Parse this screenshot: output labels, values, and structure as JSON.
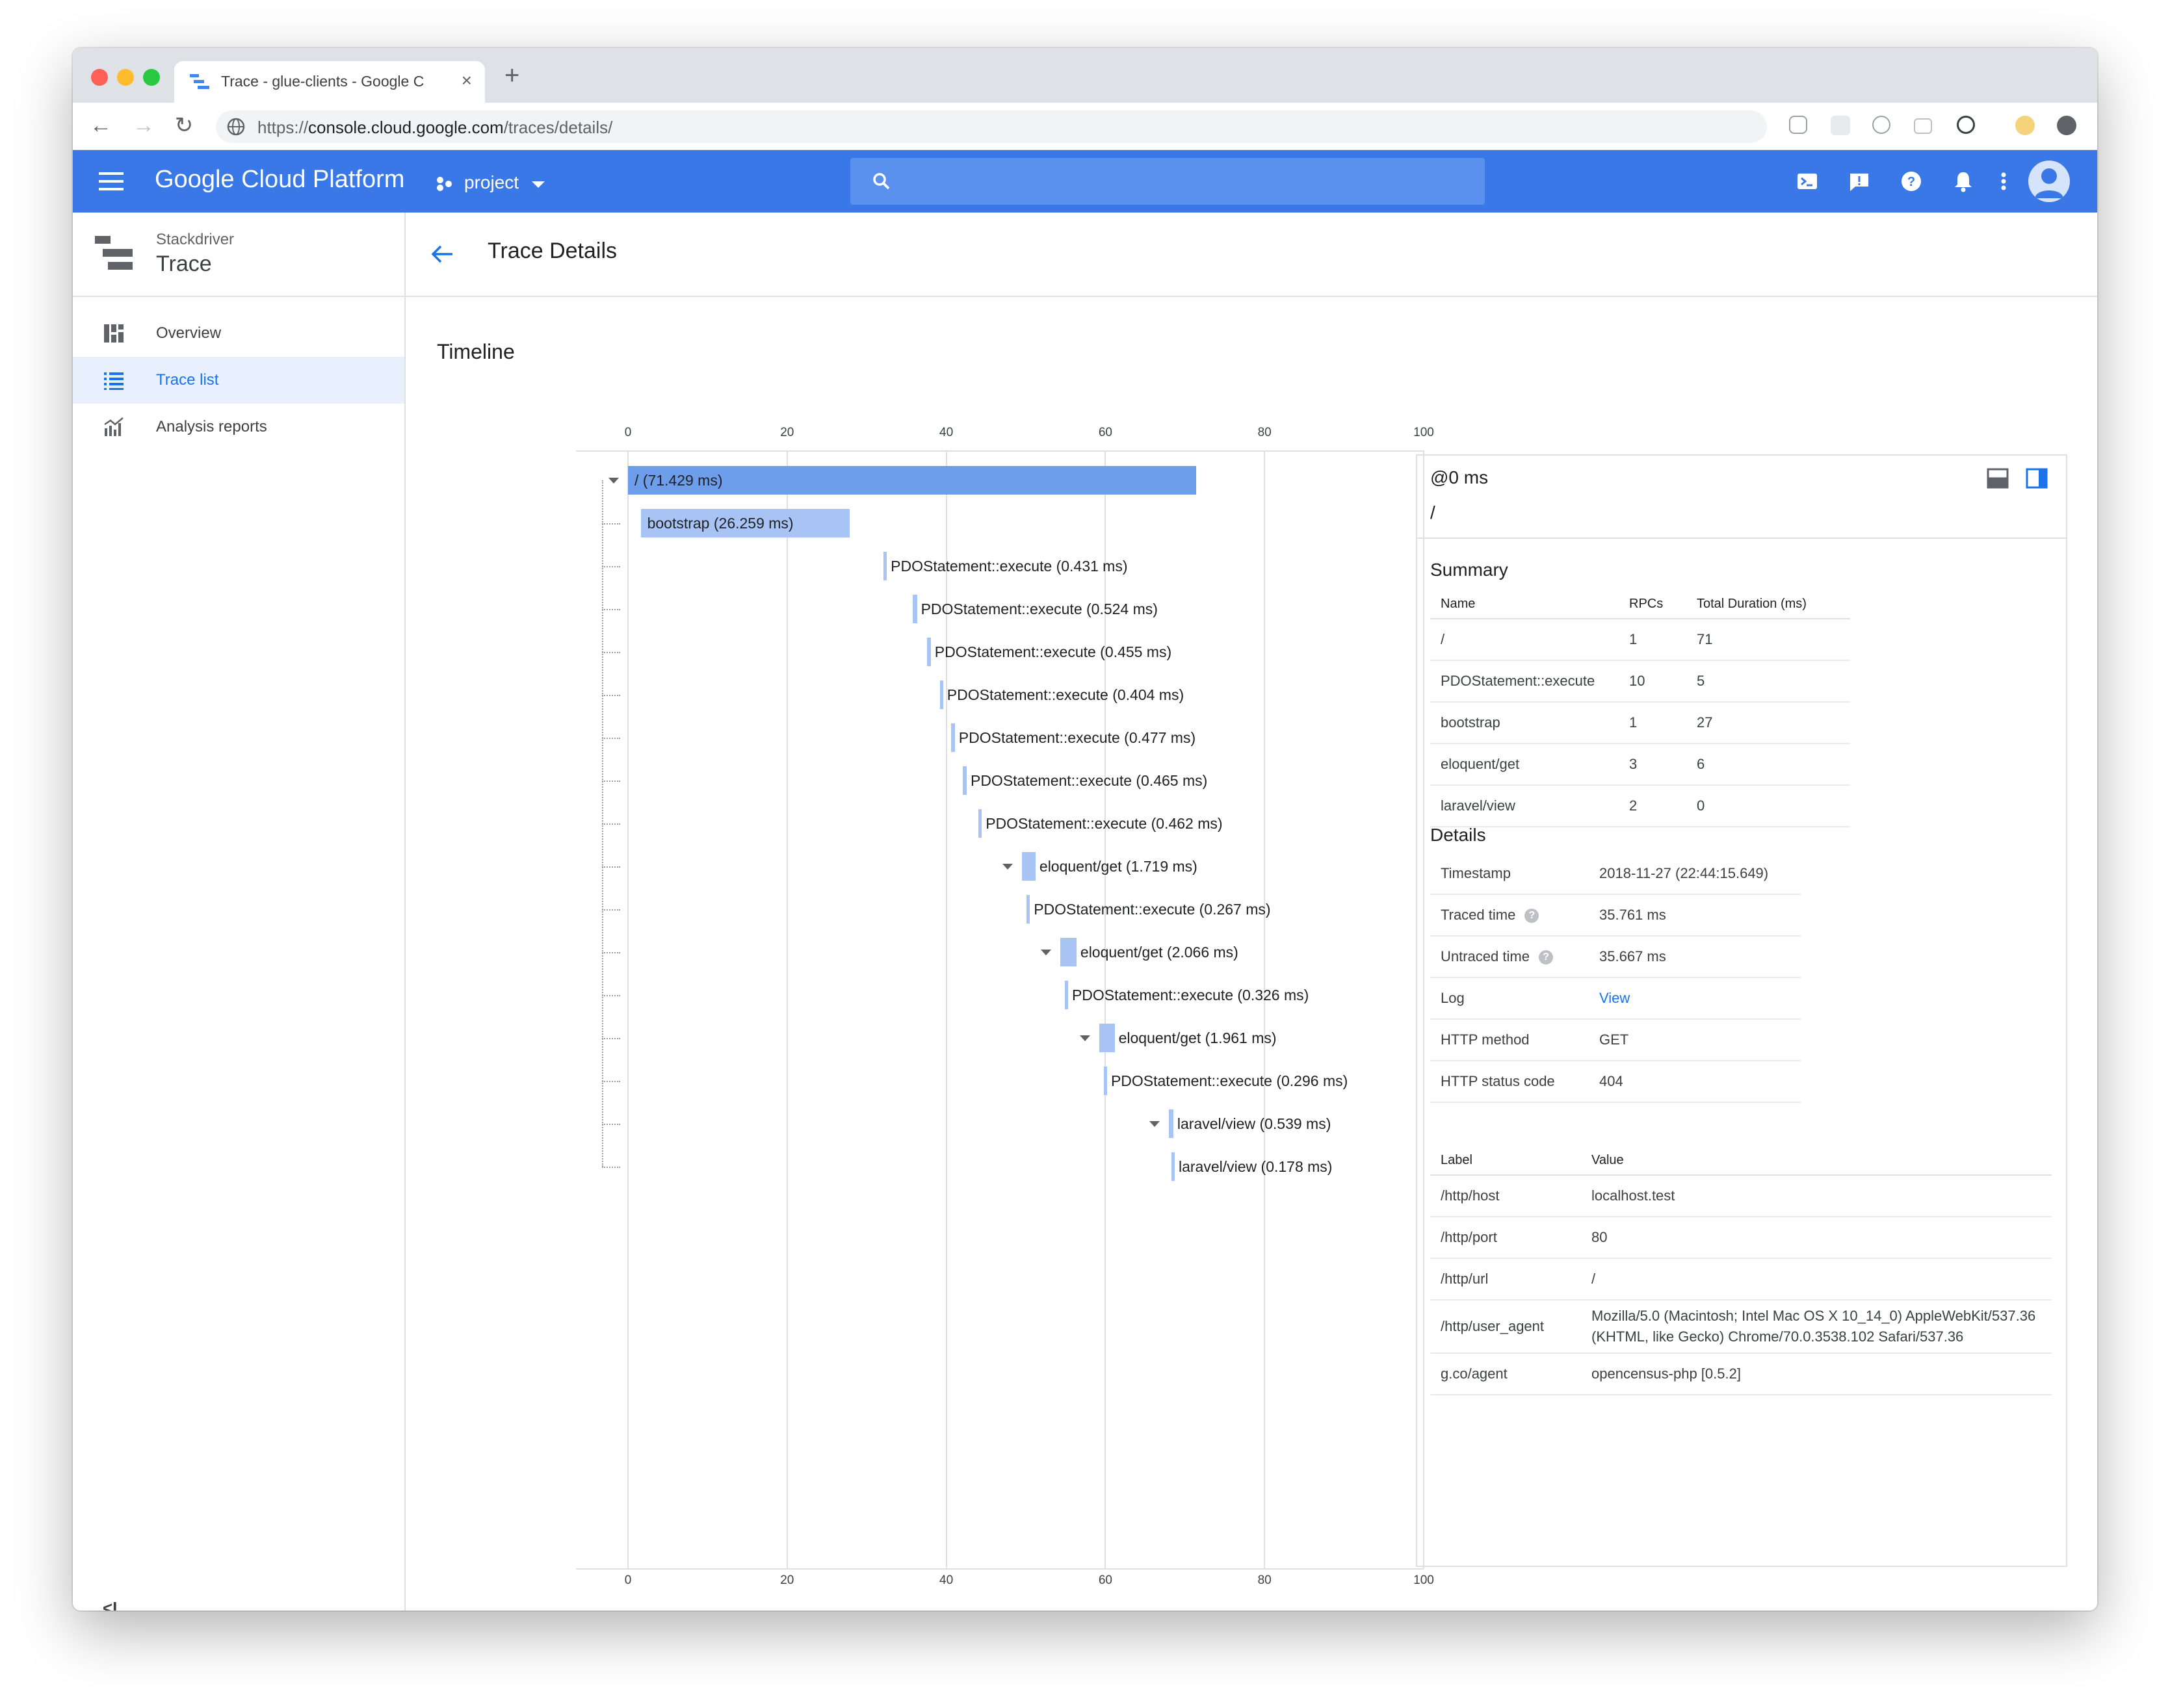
{
  "browser": {
    "tab_title": "Trace - glue-clients - Google C",
    "url_scheme": "https://",
    "url_host": "console.cloud.google.com",
    "url_path": "/traces/details/"
  },
  "header": {
    "logo": "Google Cloud Platform",
    "project_label": "project"
  },
  "sidebar": {
    "product_sub": "Stackdriver",
    "product_name": "Trace",
    "items": [
      {
        "label": "Overview",
        "icon": "dashboard-icon",
        "active": false
      },
      {
        "label": "Trace list",
        "icon": "list-icon",
        "active": true
      },
      {
        "label": "Analysis reports",
        "icon": "analytics-icon",
        "active": false
      }
    ],
    "collapse_glyph": "<I"
  },
  "page": {
    "title": "Trace Details",
    "timeline_title": "Timeline"
  },
  "chart_data": {
    "type": "bar",
    "axis_ticks": [
      "0",
      "20",
      "40",
      "60",
      "80",
      "100"
    ],
    "xlim": [
      0,
      100
    ],
    "spans": [
      {
        "label": "/ (71.429 ms)",
        "start": 0,
        "duration": 71.429,
        "depth": 0,
        "collapsible": true,
        "color": "#6d9eeb",
        "inside": true
      },
      {
        "label": "bootstrap (26.259 ms)",
        "start": 1.6,
        "duration": 26.259,
        "depth": 1,
        "collapsible": false,
        "color": "#a8c4f5",
        "inside": true
      },
      {
        "label": "PDOStatement::execute (0.431 ms)",
        "start": 32.1,
        "duration": 0.431,
        "depth": 1,
        "collapsible": false,
        "color": "#a8c4f5",
        "inside": false
      },
      {
        "label": "PDOStatement::execute (0.524 ms)",
        "start": 35.8,
        "duration": 0.524,
        "depth": 1,
        "collapsible": false,
        "color": "#a8c4f5",
        "inside": false
      },
      {
        "label": "PDOStatement::execute (0.455 ms)",
        "start": 37.6,
        "duration": 0.455,
        "depth": 1,
        "collapsible": false,
        "color": "#a8c4f5",
        "inside": false
      },
      {
        "label": "PDOStatement::execute (0.404 ms)",
        "start": 39.2,
        "duration": 0.404,
        "depth": 1,
        "collapsible": false,
        "color": "#a8c4f5",
        "inside": false
      },
      {
        "label": "PDOStatement::execute (0.477 ms)",
        "start": 40.6,
        "duration": 0.477,
        "depth": 1,
        "collapsible": false,
        "color": "#a8c4f5",
        "inside": false
      },
      {
        "label": "PDOStatement::execute (0.465 ms)",
        "start": 42.1,
        "duration": 0.465,
        "depth": 1,
        "collapsible": false,
        "color": "#a8c4f5",
        "inside": false
      },
      {
        "label": "PDOStatement::execute (0.462 ms)",
        "start": 44.0,
        "duration": 0.462,
        "depth": 1,
        "collapsible": false,
        "color": "#a8c4f5",
        "inside": false
      },
      {
        "label": "eloquent/get (1.719 ms)",
        "start": 49.5,
        "duration": 1.719,
        "depth": 1,
        "collapsible": true,
        "color": "#a8c4f5",
        "inside": false
      },
      {
        "label": "PDOStatement::execute (0.267 ms)",
        "start": 50.1,
        "duration": 0.267,
        "depth": 2,
        "collapsible": false,
        "color": "#a8c4f5",
        "inside": false
      },
      {
        "label": "eloquent/get (2.066 ms)",
        "start": 54.3,
        "duration": 2.066,
        "depth": 1,
        "collapsible": true,
        "color": "#a8c4f5",
        "inside": false
      },
      {
        "label": "PDOStatement::execute (0.326 ms)",
        "start": 54.9,
        "duration": 0.326,
        "depth": 2,
        "collapsible": false,
        "color": "#a8c4f5",
        "inside": false
      },
      {
        "label": "eloquent/get (1.961 ms)",
        "start": 59.2,
        "duration": 1.961,
        "depth": 1,
        "collapsible": true,
        "color": "#a8c4f5",
        "inside": false
      },
      {
        "label": "PDOStatement::execute (0.296 ms)",
        "start": 59.8,
        "duration": 0.296,
        "depth": 2,
        "collapsible": false,
        "color": "#a8c4f5",
        "inside": false
      },
      {
        "label": "laravel/view (0.539 ms)",
        "start": 68.0,
        "duration": 0.539,
        "depth": 1,
        "collapsible": true,
        "color": "#a8c4f5",
        "inside": false
      },
      {
        "label": "laravel/view (0.178 ms)",
        "start": 68.3,
        "duration": 0.178,
        "depth": 2,
        "collapsible": false,
        "color": "#a8c4f5",
        "inside": false
      }
    ]
  },
  "details_panel": {
    "offset": "@0 ms",
    "span_name": "/",
    "summary_title": "Summary",
    "summary_headers": [
      "Name",
      "RPCs",
      "Total Duration (ms)"
    ],
    "summary_rows": [
      [
        "/",
        "1",
        "71"
      ],
      [
        "PDOStatement::execute",
        "10",
        "5"
      ],
      [
        "bootstrap",
        "1",
        "27"
      ],
      [
        "eloquent/get",
        "3",
        "6"
      ],
      [
        "laravel/view",
        "2",
        "0"
      ]
    ],
    "details_title": "Details",
    "details": {
      "timestamp_label": "Timestamp",
      "timestamp": "2018-11-27 (22:44:15.649)",
      "traced_label": "Traced time",
      "traced": "35.761 ms",
      "untraced_label": "Untraced time",
      "untraced": "35.667 ms",
      "log_label": "Log",
      "log_link": "View",
      "method_label": "HTTP method",
      "method": "GET",
      "status_label": "HTTP status code",
      "status": "404"
    },
    "labels_headers": [
      "Label",
      "Value"
    ],
    "labels": [
      [
        "/http/host",
        "localhost.test"
      ],
      [
        "/http/port",
        "80"
      ],
      [
        "/http/url",
        "/"
      ],
      [
        "/http/user_agent",
        "Mozilla/5.0 (Macintosh; Intel Mac OS X 10_14_0) AppleWebKit/537.36 (KHTML, like Gecko) Chrome/70.0.3538.102 Safari/537.36"
      ],
      [
        "g.co/agent",
        "opencensus-php [0.5.2]"
      ]
    ]
  },
  "colors": {
    "gcp_blue": "#3b78e7",
    "root_bar": "#6d9eeb",
    "child_bar": "#a8c4f5",
    "link": "#1a73e8"
  }
}
